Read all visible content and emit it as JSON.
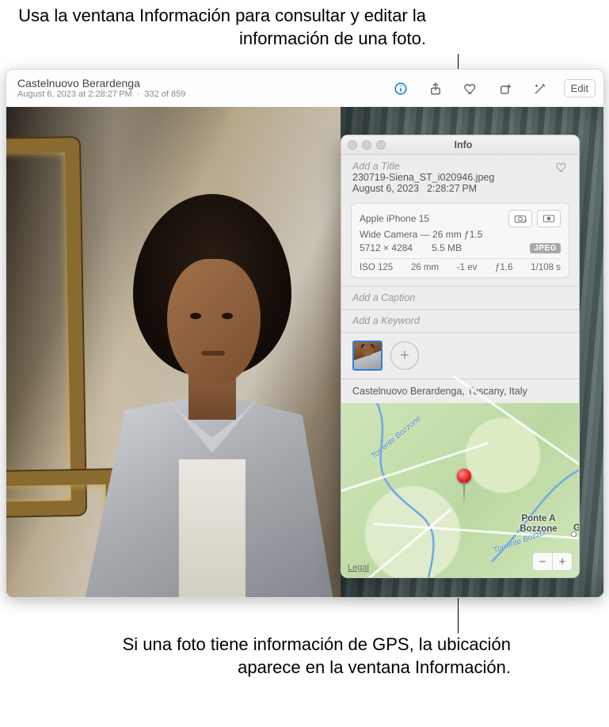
{
  "callouts": {
    "top": "Usa la ventana Información para consultar y editar la información de una foto.",
    "bottom": "Si una foto tiene información de GPS, la ubicación aparece en la ventana Información."
  },
  "toolbar": {
    "title": "Castelnuovo Berardenga",
    "timestamp": "August 6, 2023 at 2:28:27 PM",
    "counter": "332 of 859",
    "edit_label": "Edit"
  },
  "info": {
    "panel_title": "Info",
    "title_placeholder": "Add a Title",
    "filename": "230719-Siena_ST_i020946.jpeg",
    "date": "August 6, 2023",
    "time": "2:28:27 PM",
    "camera": {
      "device": "Apple iPhone 15",
      "lens": "Wide Camera — 26 mm ƒ1.5",
      "dimensions": "5712 × 4284",
      "filesize": "5.5 MB",
      "format_badge": "JPEG",
      "exif": {
        "iso": "ISO 125",
        "focal": "26 mm",
        "ev": "-1 ev",
        "aperture": "ƒ1.6",
        "shutter": "1/108 s"
      }
    },
    "caption_placeholder": "Add a Caption",
    "keyword_placeholder": "Add a Keyword",
    "location_text": "Castelnuovo Berardenga, Tuscany, Italy",
    "map": {
      "place_label": "Ponte A Bozzone",
      "place_label2": "G",
      "river_label": "Torrente Bozzone",
      "legal": "Legal"
    }
  }
}
